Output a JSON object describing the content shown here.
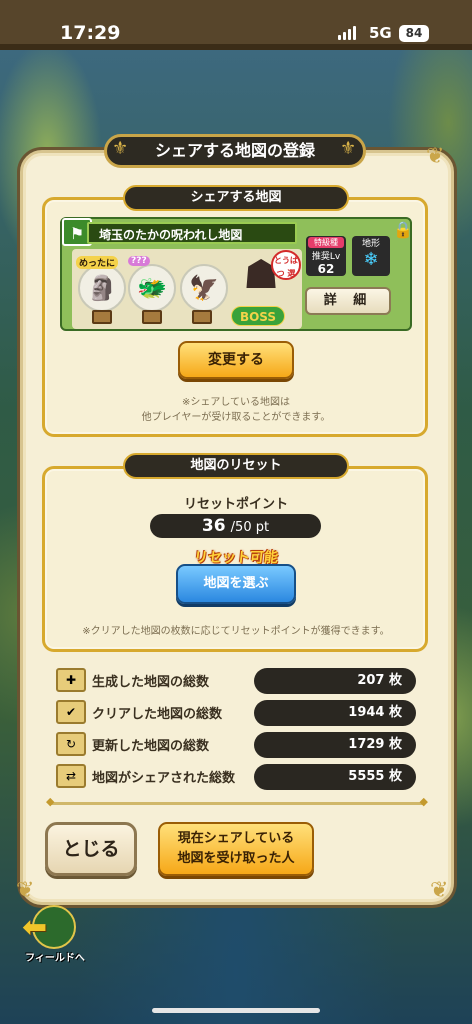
{
  "status_bar": {
    "time": "17:29",
    "network": "5G",
    "battery": "84"
  },
  "dialog": {
    "title": "シェアする地図の登録",
    "share_section": {
      "heading": "シェアする地図",
      "map_name": "埼玉のたかの呪われし地図",
      "rarity_label_1": "めったに",
      "rarity_label_2": "???",
      "boss_label": "BOSS",
      "stamp_text": "とうばつ 選",
      "rank_tag": "特級種",
      "recommended_lv_label": "推奨Lv",
      "recommended_lv": "62",
      "terrain_label": "地形",
      "detail_button": "詳 細",
      "change_button": "変更する",
      "note_line1": "※シェアしている地図は",
      "note_line2": "他プレイヤーが受け取ることができます。"
    },
    "reset_section": {
      "heading": "地図のリセット",
      "points_label": "リセットポイント",
      "points_current": "36",
      "points_max": "/50 pt",
      "reset_available": "リセット可能",
      "select_map_button": "地図を選ぶ",
      "note": "※クリアした地図の枚数に応じてリセットポイントが獲得できます。"
    },
    "stats": [
      {
        "label": "生成した地図の総数",
        "value": "207 枚",
        "icon": "map-plus-icon"
      },
      {
        "label": "クリアした地図の総数",
        "value": "1944 枚",
        "icon": "map-check-icon"
      },
      {
        "label": "更新した地図の総数",
        "value": "1729 枚",
        "icon": "map-refresh-icon"
      },
      {
        "label": "地図がシェアされた総数",
        "value": "5555 枚",
        "icon": "map-share-icon"
      }
    ],
    "close_button": "とじる",
    "receivers_button_line1": "現在シェアしている",
    "receivers_button_line2": "地図を受け取った人"
  },
  "field_button": "フィールドへ"
}
